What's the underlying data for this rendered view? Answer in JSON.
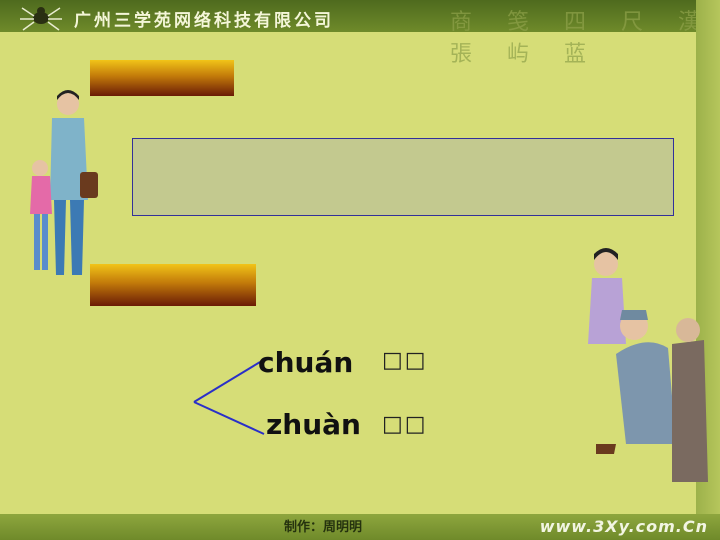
{
  "header": {
    "company": "广州三学苑网络科技有限公司",
    "decorative_text": "商 笺 四 尺 漢 張 屿 蓝"
  },
  "slide": {
    "pinyin": [
      {
        "text": "chuán",
        "chars": "□□"
      },
      {
        "text": "zhuàn",
        "chars": "□□"
      }
    ]
  },
  "footer": {
    "author": "制作：周明明",
    "site": "www.3Xy.com.Cn"
  },
  "colors": {
    "background": "#d6dd77",
    "textbox": "#c3c98f",
    "textbox_border": "#32309a",
    "bar_top": "#f1c418",
    "bar_bottom": "#6a1b06",
    "connector": "#2a2fc8"
  },
  "icons": [
    "spider-logo-icon",
    "mother-child-illustration",
    "grandfather-girl-illustration"
  ]
}
